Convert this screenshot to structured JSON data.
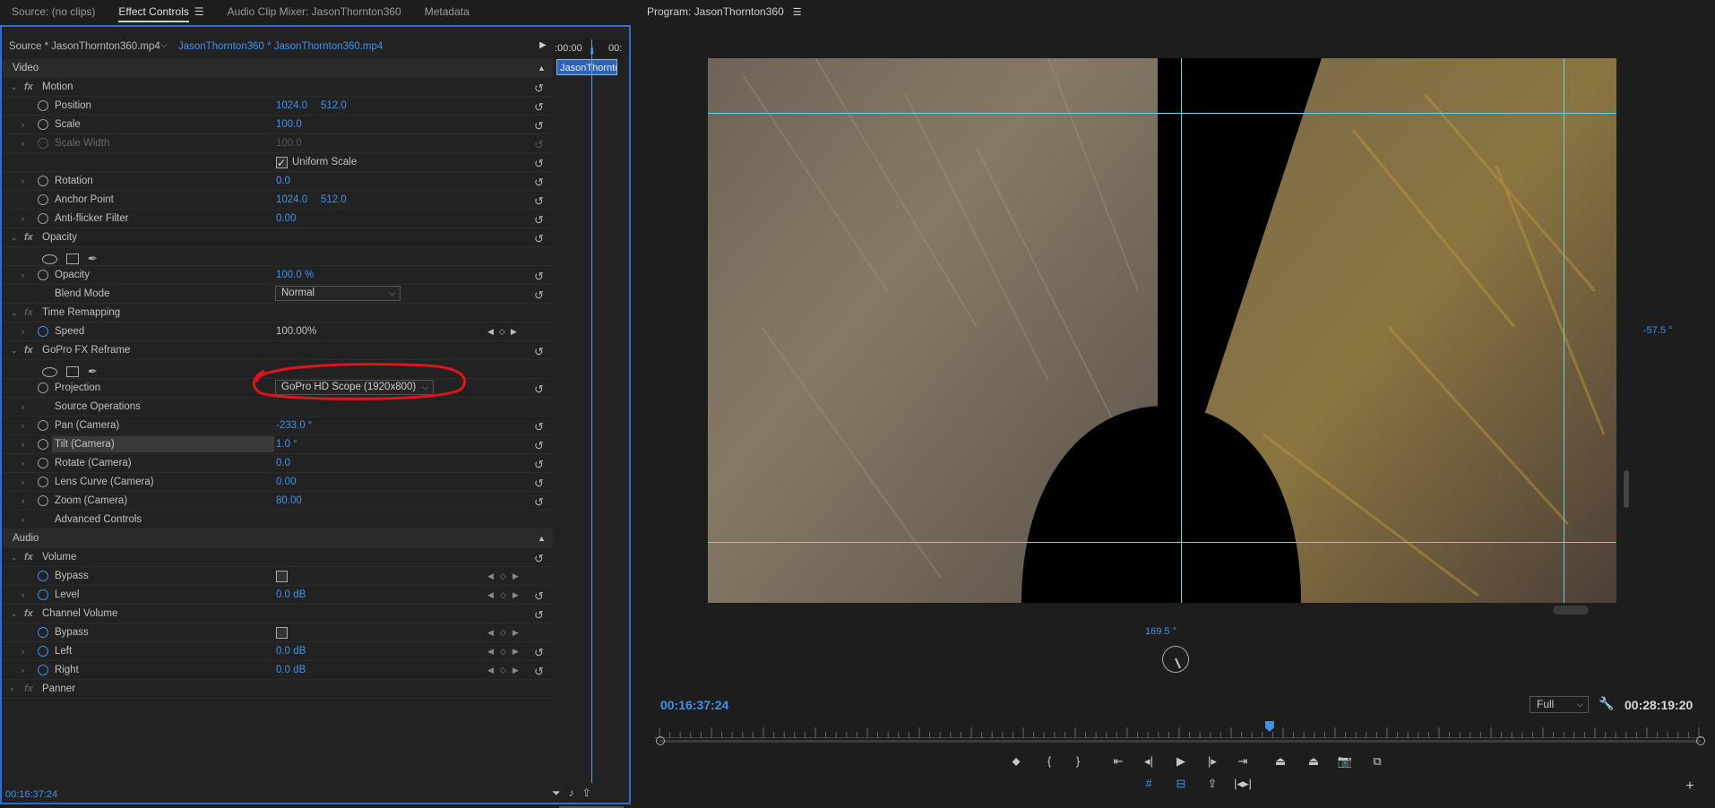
{
  "tabs": {
    "source": "Source: (no clips)",
    "effect_controls": "Effect Controls",
    "audio_mixer": "Audio Clip Mixer: JasonThornton360",
    "metadata": "Metadata"
  },
  "source_bar": {
    "master": "Source * JasonThornton360.mp4",
    "clip": "JasonThornton360 * JasonThornton360.mp4"
  },
  "mini_timeline": {
    "tc_start": ":00:00",
    "tc_end": "00:",
    "clip": "JasonThornton360"
  },
  "video_section": "Video",
  "audio_section": "Audio",
  "motion": {
    "name": "Motion",
    "position_label": "Position",
    "position_x": "1024.0",
    "position_y": "512.0",
    "scale_label": "Scale",
    "scale": "100.0",
    "scale_width_label": "Scale Width",
    "scale_width": "100.0",
    "uniform_label": "Uniform Scale",
    "rotation_label": "Rotation",
    "rotation": "0.0",
    "anchor_label": "Anchor Point",
    "anchor_x": "1024.0",
    "anchor_y": "512.0",
    "antiflicker_label": "Anti-flicker Filter",
    "antiflicker": "0.00"
  },
  "opacity": {
    "name": "Opacity",
    "opacity_label": "Opacity",
    "opacity": "100.0 %",
    "blend_label": "Blend Mode",
    "blend": "Normal"
  },
  "time_remap": {
    "name": "Time Remapping",
    "speed_label": "Speed",
    "speed": "100.00%"
  },
  "gopro": {
    "name": "GoPro FX Reframe",
    "projection_label": "Projection",
    "projection": "GoPro HD Scope  (1920x800)",
    "source_ops": "Source Operations",
    "pan_label": "Pan (Camera)",
    "pan": "-233.0 °",
    "tilt_label": "Tilt (Camera)",
    "tilt": "1.0 °",
    "rotate_label": "Rotate (Camera)",
    "rotate": "0.0",
    "lens_label": "Lens Curve (Camera)",
    "lens": "0.00",
    "zoom_label": "Zoom (Camera)",
    "zoom": "80.00",
    "advanced": "Advanced Controls"
  },
  "volume": {
    "name": "Volume",
    "bypass_label": "Bypass",
    "level_label": "Level",
    "level": "0.0 dB"
  },
  "channel_volume": {
    "name": "Channel Volume",
    "bypass_label": "Bypass",
    "left_label": "Left",
    "left": "0.0 dB",
    "right_label": "Right",
    "right": "0.0 dB"
  },
  "panner": {
    "name": "Panner"
  },
  "ec_timecode": "00:16:37:24",
  "program": {
    "title": "Program: JasonThornton360",
    "timecode_current": "00:16:37:24",
    "timecode_duration": "00:28:19:20",
    "fit": "Full",
    "tilt_readout": "-57.5 °",
    "pan_readout": "169.5 °",
    "playhead_fraction": 0.587
  },
  "colors": {
    "accent": "#3a94f0",
    "panel_border": "#2d6fd6",
    "guide": "#5fd6e6",
    "annotation": "#e0141c"
  }
}
